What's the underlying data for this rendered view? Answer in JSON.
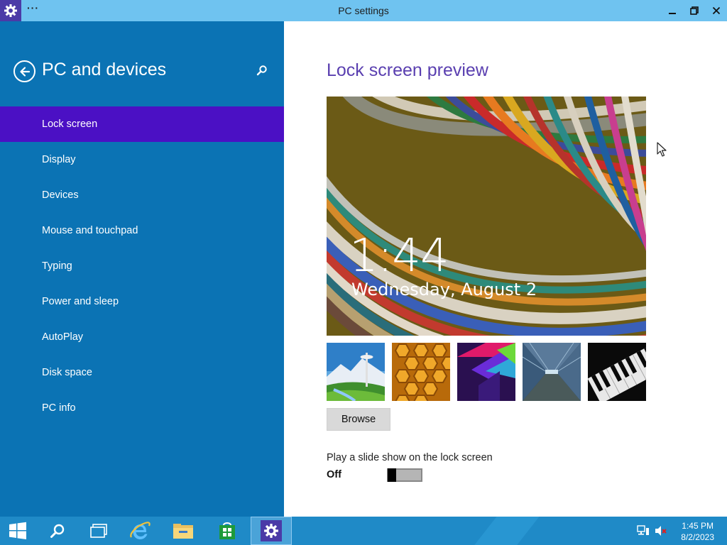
{
  "window": {
    "title": "PC settings",
    "menu_dots": "···"
  },
  "nav": {
    "heading": "PC and devices",
    "items": [
      {
        "label": "Lock screen",
        "selected": true
      },
      {
        "label": "Display",
        "selected": false
      },
      {
        "label": "Devices",
        "selected": false
      },
      {
        "label": "Mouse and touchpad",
        "selected": false
      },
      {
        "label": "Typing",
        "selected": false
      },
      {
        "label": "Power and sleep",
        "selected": false
      },
      {
        "label": "AutoPlay",
        "selected": false
      },
      {
        "label": "Disk space",
        "selected": false
      },
      {
        "label": "PC info",
        "selected": false
      }
    ]
  },
  "main": {
    "section_title": "Lock screen preview",
    "preview_time": "1:44",
    "preview_date": "Wednesday, August 2",
    "thumbnails": [
      "space-needle-landscape",
      "honeycomb",
      "colorful-geometric",
      "train-tunnel",
      "piano-keys"
    ],
    "browse_label": "Browse",
    "slideshow_label": "Play a slide show on the lock screen",
    "slideshow_state": "Off",
    "slideshow_on": false
  },
  "taskbar": {
    "apps": [
      "start-icon",
      "search-icon",
      "task-view-icon",
      "internet-explorer-icon",
      "file-explorer-icon",
      "store-icon",
      "settings-icon"
    ],
    "clock_time": "1:45 PM",
    "clock_date": "8/2/2023"
  },
  "colors": {
    "nav_bg": "#0b73b4",
    "nav_selected": "#4b10c4",
    "title_bar": "#6fc3f0",
    "accent_title": "#5a3fb0",
    "taskbar": "#1f8ac7"
  }
}
